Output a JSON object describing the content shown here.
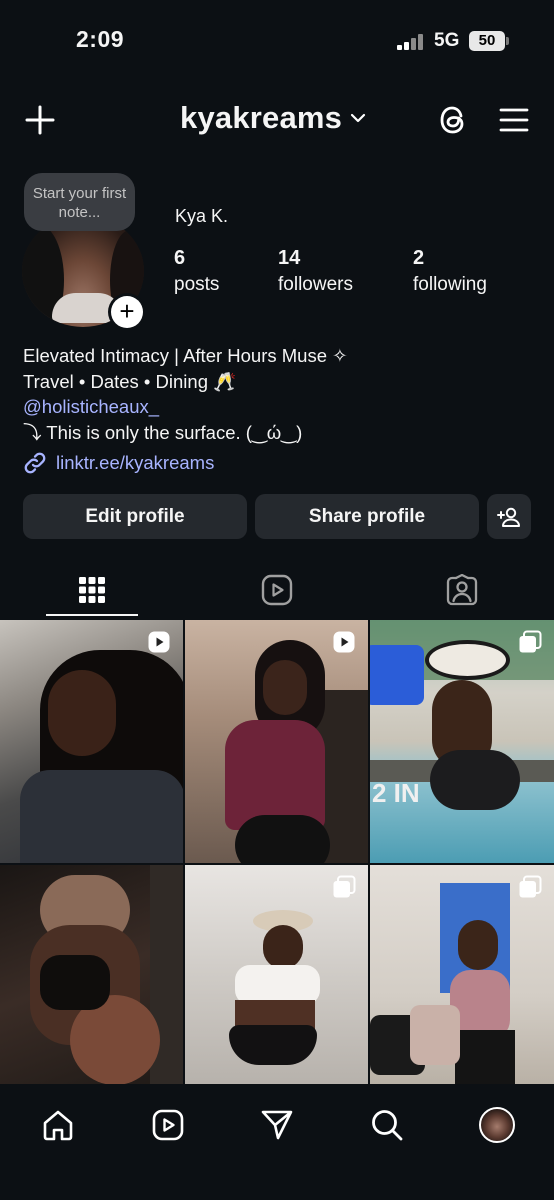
{
  "status_bar": {
    "time": "2:09",
    "network": "5G",
    "battery": "50"
  },
  "header": {
    "username": "kyakreams"
  },
  "profile": {
    "note": "Start your first note...",
    "display_name": "Kya K.",
    "stats": [
      {
        "value": "6",
        "label": "posts"
      },
      {
        "value": "14",
        "label": "followers"
      },
      {
        "value": "2",
        "label": "following"
      }
    ],
    "bio": [
      "Elevated Intimacy | After Hours Muse ✧",
      "Travel • Dates • Dining 🥂",
      "@holisticheaux_",
      "⤵ This is only the surface. (‿ώ‿)"
    ],
    "link": "linktr.ee/kyakreams"
  },
  "buttons": {
    "edit": "Edit profile",
    "share": "Share profile"
  },
  "grid_posts": [
    {
      "type": "reel"
    },
    {
      "type": "reel"
    },
    {
      "type": "carousel",
      "overlay_text": "2 IN"
    },
    {
      "type": "none"
    },
    {
      "type": "carousel"
    },
    {
      "type": "carousel"
    }
  ],
  "colors": {
    "background": "#0c1014",
    "button": "#25292e",
    "link": "#a8b4ff",
    "note_bubble": "#3a3d42"
  }
}
